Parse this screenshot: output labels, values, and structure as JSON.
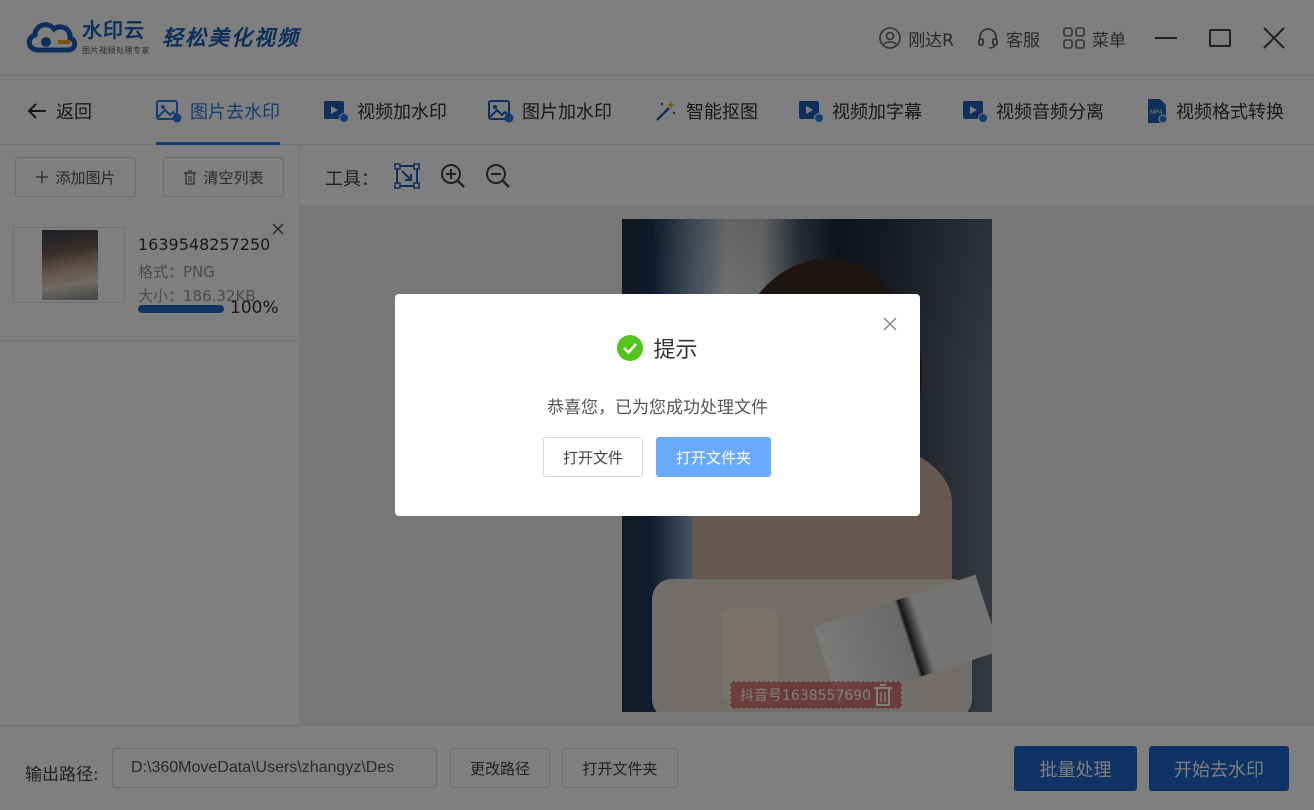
{
  "header": {
    "brand_name": "水印云",
    "brand_subtitle": "图片视频处理专家",
    "slogan": "轻松美化视频",
    "user_label": "刚达R",
    "service_label": "客服",
    "menu_label": "菜单"
  },
  "nav": {
    "back_label": "返回",
    "items": [
      {
        "label": "图片去水印",
        "active": true
      },
      {
        "label": "视频加水印"
      },
      {
        "label": "图片加水印"
      },
      {
        "label": "智能抠图"
      },
      {
        "label": "视频加字幕"
      },
      {
        "label": "视频音频分离"
      },
      {
        "label": "视频格式转换"
      }
    ]
  },
  "left_panel": {
    "add_button": "添加图片",
    "clear_button": "清空列表",
    "file": {
      "name": "1639548257250",
      "format": "格式：PNG",
      "size": "大小：186.32KB",
      "progress": 100,
      "progress_text": "100%"
    }
  },
  "toolbar": {
    "label": "工具："
  },
  "preview": {
    "watermark_text": "抖音号1638557690"
  },
  "bottom": {
    "output_label": "输出路径:",
    "output_path": "D:\\360MoveData\\Users\\zhangyz\\Des",
    "change_path_button": "更改路径",
    "open_folder_button": "打开文件夹",
    "batch_button": "批量处理",
    "start_button": "开始去水印"
  },
  "dialog": {
    "title": "提示",
    "message": "恭喜您，已为您成功处理文件",
    "open_file_button": "打开文件",
    "open_folder_button": "打开文件夹"
  },
  "colors": {
    "accent": "#2c7be5",
    "primary_button": "#1f67c8",
    "dialog_primary": "#69aafe",
    "success": "#52c41a"
  }
}
